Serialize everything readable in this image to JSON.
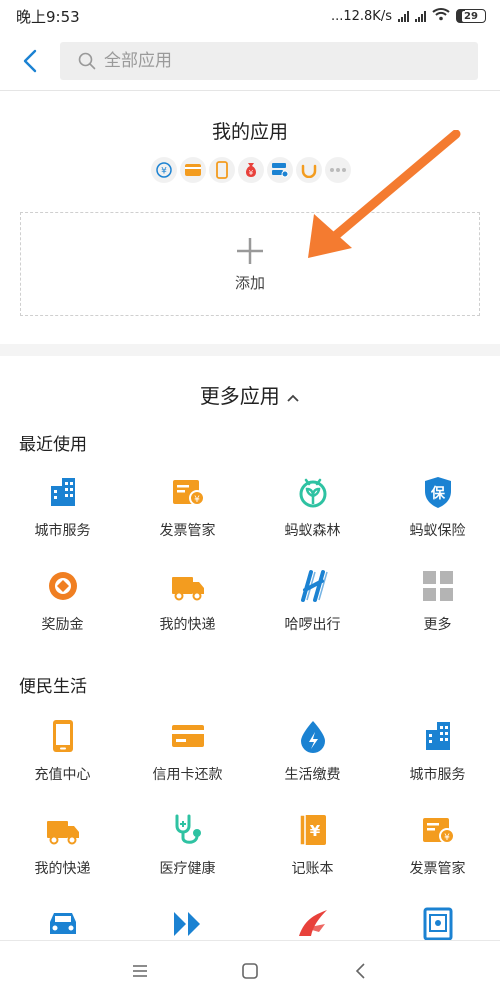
{
  "status": {
    "time": "晚上9:53",
    "network_speed": "...12.8K/s",
    "battery_level": "29"
  },
  "header": {
    "search_placeholder": "全部应用",
    "icons": [
      "back-icon",
      "search-icon"
    ]
  },
  "my_apps": {
    "title": "我的应用",
    "icons": [
      "transfer-icon",
      "card-icon",
      "phone-icon",
      "money-bag-icon",
      "server-icon",
      "didi-icon",
      "more-dots-icon"
    ],
    "add_label": "添加"
  },
  "more_apps": {
    "title": "更多应用",
    "recent": {
      "title": "最近使用",
      "items": [
        {
          "label": "城市服务",
          "icon": "city-service-icon",
          "color": "#1b82d2"
        },
        {
          "label": "发票管家",
          "icon": "invoice-icon",
          "color": "#f39c1f"
        },
        {
          "label": "蚂蚁森林",
          "icon": "ant-forest-icon",
          "color": "#2ec2a2"
        },
        {
          "label": "蚂蚁保险",
          "icon": "insurance-shield-icon",
          "color": "#1b82d2"
        },
        {
          "label": "奖励金",
          "icon": "reward-icon",
          "color": "#f07f22"
        },
        {
          "label": "我的快递",
          "icon": "delivery-truck-icon",
          "color": "#f39c1f"
        },
        {
          "label": "哈啰出行",
          "icon": "hello-bike-icon",
          "color": "#1b82d2"
        },
        {
          "label": "更多",
          "icon": "more-grid-icon",
          "color": "#b4b4b4"
        }
      ]
    },
    "life": {
      "title": "便民生活",
      "items": [
        {
          "label": "充值中心",
          "icon": "phone-recharge-icon",
          "color": "#f39c1f"
        },
        {
          "label": "信用卡还款",
          "icon": "credit-card-icon",
          "color": "#f39c1f"
        },
        {
          "label": "生活缴费",
          "icon": "utility-drop-icon",
          "color": "#1b82d2"
        },
        {
          "label": "城市服务",
          "icon": "city-service-icon",
          "color": "#1b82d2"
        },
        {
          "label": "我的快递",
          "icon": "delivery-truck-icon",
          "color": "#f39c1f"
        },
        {
          "label": "医疗健康",
          "icon": "stethoscope-icon",
          "color": "#2ec2a2"
        },
        {
          "label": "记账本",
          "icon": "account-book-icon",
          "color": "#f39c1f"
        },
        {
          "label": "发票管家",
          "icon": "invoice-icon",
          "color": "#f39c1f"
        },
        {
          "label": "",
          "icon": "car-icon",
          "color": "#1b82d2"
        },
        {
          "label": "",
          "icon": "forward-chevrons-icon",
          "color": "#1b82d2"
        },
        {
          "label": "",
          "icon": "airline-icon",
          "color": "#e8413b"
        },
        {
          "label": "",
          "icon": "safe-box-icon",
          "color": "#1b82d2"
        }
      ]
    }
  },
  "nav": [
    "menu-icon",
    "home-square-icon",
    "back-chevron-icon"
  ],
  "colors": {
    "accent": "#1b82d2",
    "orange": "#f39c1f",
    "arrow": "#f47b30"
  }
}
